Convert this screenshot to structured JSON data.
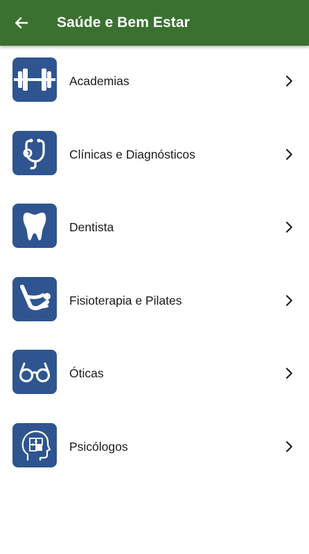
{
  "app_bar": {
    "title": "Saúde e Bem Estar",
    "color": "#3a7130",
    "back_icon": "arrow-left-icon"
  },
  "accent": "#2f5590",
  "categories": [
    {
      "label": "Academias",
      "icon": "dumbbell-icon"
    },
    {
      "label": "Clínicas e Diagnósticos",
      "icon": "stethoscope-icon"
    },
    {
      "label": "Dentista",
      "icon": "tooth-icon"
    },
    {
      "label": "Fisioterapia e Pilates",
      "icon": "pilates-pose-icon"
    },
    {
      "label": "Óticas",
      "icon": "eyeglasses-icon"
    },
    {
      "label": "Psicólogos",
      "icon": "head-puzzle-icon"
    }
  ],
  "chevron_icon": "chevron-right-icon"
}
